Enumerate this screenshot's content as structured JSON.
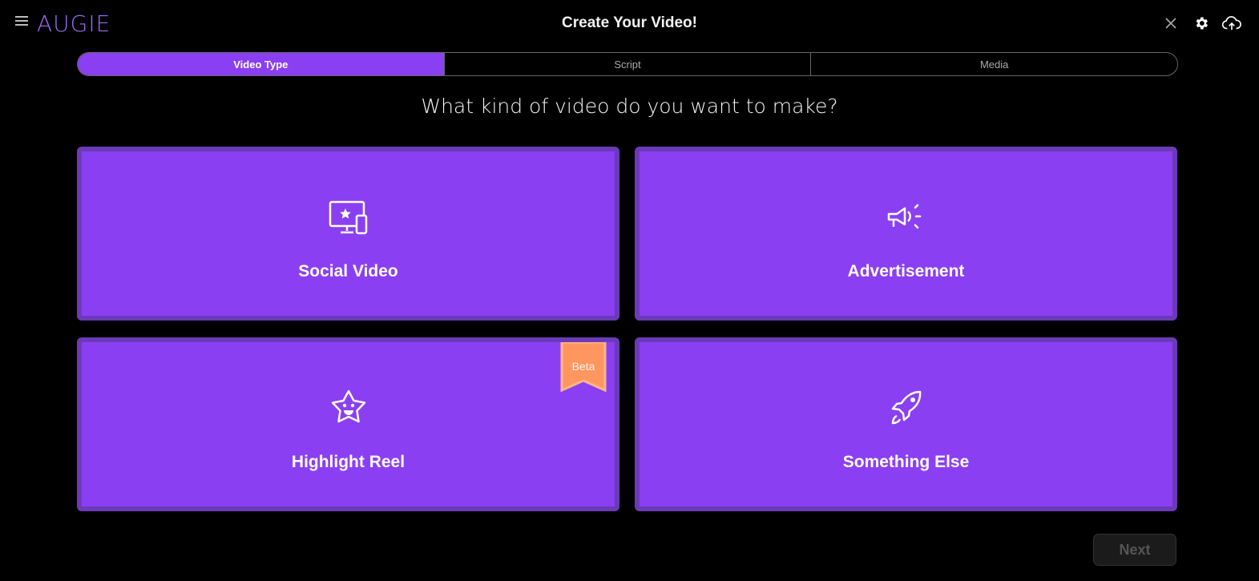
{
  "header": {
    "logo": "AUGIE",
    "title": "Create Your Video!",
    "icons": [
      "menu-icon",
      "close-icon",
      "gear-icon",
      "cloud-upload-icon"
    ]
  },
  "stepper": {
    "steps": [
      {
        "label": "Video Type",
        "active": true
      },
      {
        "label": "Script",
        "active": false
      },
      {
        "label": "Media",
        "active": false
      }
    ]
  },
  "main": {
    "question": "What kind of video do you want to make?",
    "cards": [
      {
        "label": "Social Video",
        "icon": "devices-star-icon"
      },
      {
        "label": "Advertisement",
        "icon": "megaphone-icon"
      },
      {
        "label": "Highlight Reel",
        "icon": "smiling-star-icon",
        "badge": "Beta"
      },
      {
        "label": "Something Else",
        "icon": "rocket-icon"
      }
    ]
  },
  "footer": {
    "next_label": "Next"
  },
  "colors": {
    "accent": "#8b3ff2",
    "card_border": "#6c3ab8",
    "badge": "#ff9660"
  }
}
